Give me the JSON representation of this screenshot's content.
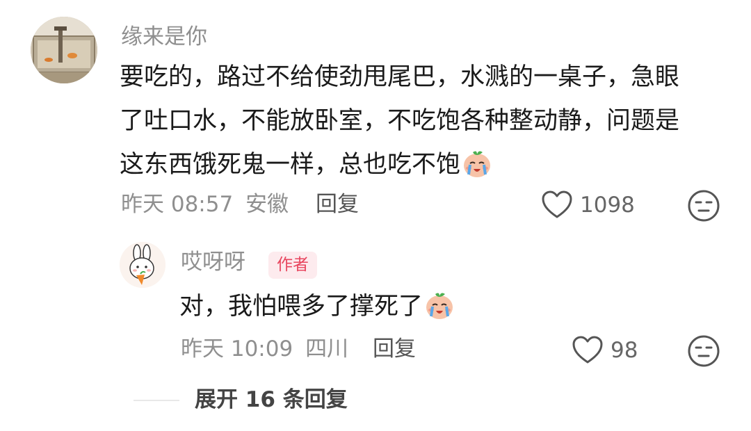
{
  "comment": {
    "username": "缘来是你",
    "text_lines": [
      "要吃的，路过不给使劲甩尾巴，水溅的一桌子，急眼",
      "了吐口水，不能放卧室，不吃饱各种整动静，问题是",
      "这东西饿死鬼一样，总也吃不饱"
    ],
    "trailing_emoji": "crying-face-emoji",
    "timestamp": "昨天 08:57",
    "location": "安徽",
    "reply_label": "回复",
    "like_count": "1098",
    "like_icon": "heart-outline-icon",
    "dislike_icon": "meh-face-icon"
  },
  "reply": {
    "username": "哎呀呀",
    "author_badge": "作者",
    "text": "对，我怕喂多了撑死了",
    "trailing_emoji": "crying-face-emoji",
    "timestamp": "昨天 10:09",
    "location": "四川",
    "reply_label": "回复",
    "like_count": "98",
    "like_icon": "heart-outline-icon",
    "dislike_icon": "meh-face-icon"
  },
  "expand_replies": {
    "label": "展开 16 条回复"
  },
  "colors": {
    "secondary_text": "#8f8f8f",
    "author_badge_bg": "#fdebee",
    "author_badge_text": "#e8455e"
  }
}
